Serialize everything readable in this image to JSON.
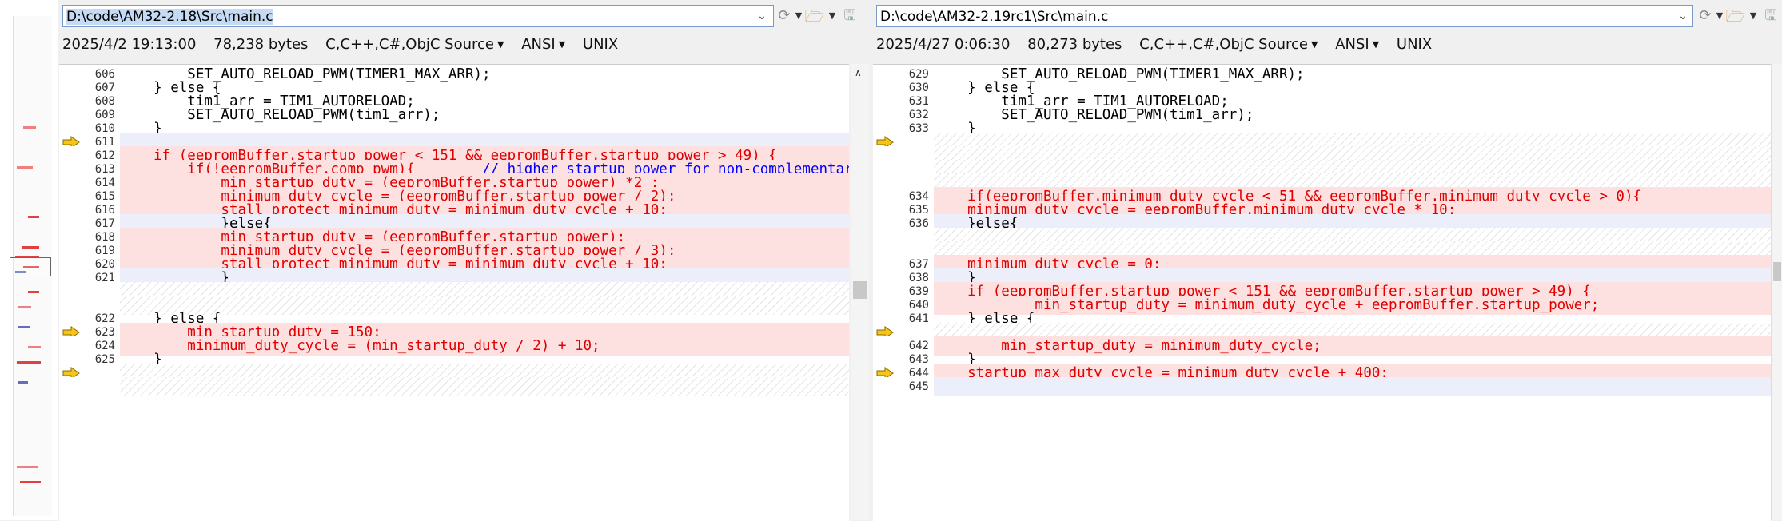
{
  "left": {
    "path": "D:\\code\\AM32-2.18\\Src\\main.c",
    "info": {
      "date": "2025/4/2 19:13:00",
      "size": "78,238 bytes",
      "format": "C,C++,C#,ObjC Source",
      "encoding": "ANSI",
      "eol": "UNIX"
    },
    "lines": [
      {
        "n": "606",
        "t": "        SET_AUTO_RELOAD_PWM(TIMER1_MAX_ARR);",
        "k": "n"
      },
      {
        "n": "607",
        "t": "    } else {",
        "k": "n"
      },
      {
        "n": "608",
        "t": "        tim1_arr = TIM1_AUTORELOAD;",
        "k": "n"
      },
      {
        "n": "609",
        "t": "        SET_AUTO_RELOAD_PWM(tim1_arr);",
        "k": "n"
      },
      {
        "n": "610",
        "t": "    }",
        "k": "n"
      },
      {
        "n": "611",
        "t": "",
        "k": "b"
      },
      {
        "n": "612",
        "t": "    if (eepromBuffer.startup_power < 151 && eepromBuffer.startup_power > 49) {",
        "k": "d"
      },
      {
        "n": "613",
        "t": "        if(!eepromBuffer.comp_pwm){        // higher startup power for non-complementary",
        "k": "d",
        "c": "// higher startup power for non-complementary"
      },
      {
        "n": "614",
        "t": "            min_startup_duty = (eepromBuffer.startup_power) *2 ;",
        "k": "d"
      },
      {
        "n": "615",
        "t": "            minimum_duty_cycle = (eepromBuffer.startup_power / 2);",
        "k": "d"
      },
      {
        "n": "616",
        "t": "            stall_protect_minimum_duty = minimum_duty_cycle + 10;",
        "k": "d"
      },
      {
        "n": "617",
        "t": "            }else{",
        "k": "b"
      },
      {
        "n": "618",
        "t": "            min_startup_duty = (eepromBuffer.startup_power);",
        "k": "d"
      },
      {
        "n": "619",
        "t": "            minimum_duty_cycle = (eepromBuffer.startup_power / 3);",
        "k": "d"
      },
      {
        "n": "620",
        "t": "            stall_protect_minimum_duty = minimum_duty_cycle + 10;",
        "k": "d"
      },
      {
        "n": "621",
        "t": "            }",
        "k": "b"
      },
      {
        "n": "",
        "t": "",
        "k": "h"
      },
      {
        "n": "",
        "t": "",
        "k": "h"
      },
      {
        "n": "622",
        "t": "    } else {",
        "k": "n"
      },
      {
        "n": "623",
        "t": "        min_startup_duty = 150;",
        "k": "d"
      },
      {
        "n": "624",
        "t": "        minimum_duty_cycle = (min_startup_duty / 2) + 10;",
        "k": "d"
      },
      {
        "n": "625",
        "t": "    }",
        "k": "n"
      },
      {
        "n": "",
        "t": "",
        "k": "h"
      },
      {
        "n": "",
        "t": "",
        "k": "h"
      }
    ]
  },
  "right": {
    "path": "D:\\code\\AM32-2.19rc1\\Src\\main.c",
    "info": {
      "date": "2025/4/27 0:06:30",
      "size": "80,273 bytes",
      "format": "C,C++,C#,ObjC Source",
      "encoding": "ANSI",
      "eol": "UNIX"
    },
    "lines": [
      {
        "n": "629",
        "t": "        SET_AUTO_RELOAD_PWM(TIMER1_MAX_ARR);",
        "k": "n"
      },
      {
        "n": "630",
        "t": "    } else {",
        "k": "n"
      },
      {
        "n": "631",
        "t": "        tim1_arr = TIM1_AUTORELOAD;",
        "k": "n"
      },
      {
        "n": "632",
        "t": "        SET_AUTO_RELOAD_PWM(tim1_arr);",
        "k": "n"
      },
      {
        "n": "633",
        "t": "    }",
        "k": "n"
      },
      {
        "n": "",
        "t": "",
        "k": "h"
      },
      {
        "n": "",
        "t": "",
        "k": "h"
      },
      {
        "n": "",
        "t": "",
        "k": "h"
      },
      {
        "n": "",
        "t": "",
        "k": "h"
      },
      {
        "n": "634",
        "t": "    if(eepromBuffer.minimum_duty_cycle < 51 && eepromBuffer.minimum_duty_cycle > 0){",
        "k": "d"
      },
      {
        "n": "635",
        "t": "    minimum_duty_cycle = eepromBuffer.minimum_duty_cycle * 10;",
        "k": "d"
      },
      {
        "n": "636",
        "t": "    }else{",
        "k": "b"
      },
      {
        "n": "",
        "t": "",
        "k": "h"
      },
      {
        "n": "",
        "t": "",
        "k": "h"
      },
      {
        "n": "637",
        "t": "    minimum_duty_cycle = 0;",
        "k": "d"
      },
      {
        "n": "638",
        "t": "    }",
        "k": "b"
      },
      {
        "n": "639",
        "t": "    if (eepromBuffer.startup_power < 151 && eepromBuffer.startup_power > 49) {",
        "k": "d"
      },
      {
        "n": "640",
        "t": "            min_startup_duty = minimum_duty_cycle + eepromBuffer.startup_power;",
        "k": "d"
      },
      {
        "n": "641",
        "t": "    } else {",
        "k": "n"
      },
      {
        "n": "",
        "t": "",
        "k": "h"
      },
      {
        "n": "642",
        "t": "        min_startup_duty = minimum_duty_cycle;",
        "k": "d"
      },
      {
        "n": "643",
        "t": "    }",
        "k": "n"
      },
      {
        "n": "644",
        "t": "    startup_max_duty_cycle = minimum_duty_cycle + 400;",
        "k": "d"
      },
      {
        "n": "645",
        "t": "",
        "k": "b"
      }
    ]
  },
  "left_arrows": [
    5,
    19,
    22
  ],
  "right_arrows": [
    5,
    19,
    22
  ],
  "colors": {
    "diff_bg": "#fde0e0",
    "diff_text": "#e00000",
    "blank_bg": "#eceefa",
    "comment": "#0000ff",
    "selection": "#c5daf3"
  },
  "overview_marks": [
    {
      "y": 0.22,
      "c": "#f08080",
      "w": 16,
      "x": 28
    },
    {
      "y": 0.3,
      "c": "#f08080",
      "w": 20,
      "x": 20
    },
    {
      "y": 0.4,
      "c": "#e04040",
      "w": 14,
      "x": 34
    },
    {
      "y": 0.46,
      "c": "#e04040",
      "w": 22,
      "x": 26
    },
    {
      "y": 0.48,
      "c": "#e04040",
      "w": 30,
      "x": 18
    },
    {
      "y": 0.5,
      "c": "#e04040",
      "w": 20,
      "x": 28
    },
    {
      "y": 0.51,
      "c": "#6070c0",
      "w": 14,
      "x": 18
    },
    {
      "y": 0.55,
      "c": "#e04040",
      "w": 14,
      "x": 34
    },
    {
      "y": 0.58,
      "c": "#f08080",
      "w": 16,
      "x": 22
    },
    {
      "y": 0.62,
      "c": "#6070c0",
      "w": 14,
      "x": 22
    },
    {
      "y": 0.66,
      "c": "#f08080",
      "w": 16,
      "x": 34
    },
    {
      "y": 0.69,
      "c": "#e04040",
      "w": 30,
      "x": 20
    },
    {
      "y": 0.73,
      "c": "#6070c0",
      "w": 12,
      "x": 22
    },
    {
      "y": 0.9,
      "c": "#f08080",
      "w": 26,
      "x": 20
    },
    {
      "y": 0.93,
      "c": "#e04040",
      "w": 26,
      "x": 24
    }
  ]
}
